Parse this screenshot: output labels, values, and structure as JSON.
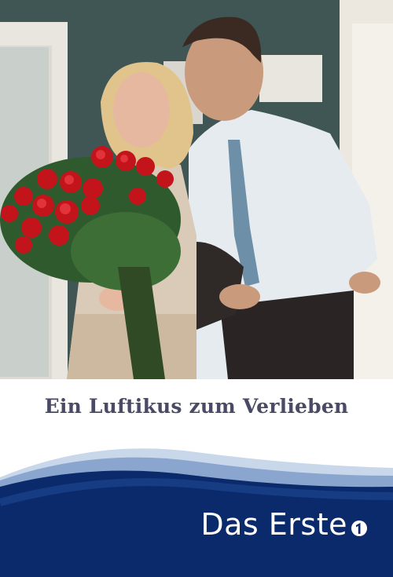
{
  "poster": {
    "title": "Ein Luftikus zum Verlieben",
    "broadcaster": "Das Erste",
    "broadcaster_logo_icon": "ard-one-logo-icon"
  },
  "colors": {
    "title_text": "#4a4a66",
    "band_navy": "#0b2a6b",
    "band_light": "#dfe8f4",
    "wall_green": "#3f5654",
    "roses_red": "#c4141b"
  }
}
